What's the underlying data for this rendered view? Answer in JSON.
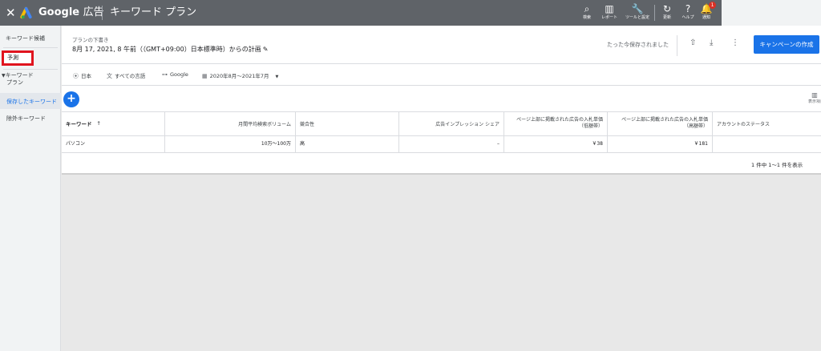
{
  "topbar": {
    "close": "✕",
    "brand_google": "Google",
    "brand_ads": "広告",
    "title": "キーワード プラン",
    "tools": [
      {
        "icon": "search-icon",
        "glyph": "⌕",
        "label": "検索"
      },
      {
        "icon": "report-icon",
        "glyph": "▥",
        "label": "レポート"
      },
      {
        "icon": "wrench-icon",
        "glyph": "🔧",
        "label": "ツールと設定"
      },
      {
        "icon": "refresh-icon",
        "glyph": "↻",
        "label": "更新"
      },
      {
        "icon": "help-icon",
        "glyph": "?",
        "label": "ヘルプ"
      },
      {
        "icon": "bell-icon",
        "glyph": "🔔",
        "label": "通知"
      }
    ],
    "notification_count": "1"
  },
  "sidebar": {
    "keyword_ideas": "キーワード候補",
    "forecast": "予測",
    "keyword_plan_line1": "キーワード",
    "keyword_plan_line2": "プラン",
    "saved_keywords": "保存したキーワード",
    "negative_keywords": "除外キーワード"
  },
  "header": {
    "draft_label": "プランの下書き",
    "plan_title": "8月 17, 2021, 8 午前（（GMT+09:00）日本標準時）からの計画",
    "saved_text": "たった今保存されました",
    "campaign_button": "キャンペーンの作成"
  },
  "filters": {
    "location": "日本",
    "language": "すべての言語",
    "network": "Google",
    "date_range": "2020年8月～2021年7月"
  },
  "columns_label": "表示項目",
  "table": {
    "headers": {
      "keyword": "キーワード",
      "sort_arrow": "↑",
      "volume": "月間平均検索ボリューム",
      "competition": "競合性",
      "impression_share": "広告インプレッション シェア",
      "bid_low_line1": "ページ上部に掲載された広告の入札単価",
      "bid_low_line2": "（低額帯）",
      "bid_high_line1": "ページ上部に掲載された広告の入札単価",
      "bid_high_line2": "（高額帯）",
      "account_status": "アカウントのステータス"
    },
    "rows": [
      {
        "keyword": "パソコン",
        "volume": "10万～100万",
        "competition": "高",
        "impression_share": "–",
        "bid_low": "￥38",
        "bid_high": "￥181",
        "account_status": ""
      }
    ]
  },
  "pagination": "1 件中 1～1 件を表示",
  "colors": {
    "topbar": "#5f6368",
    "primary_blue": "#1a73e8",
    "highlight_red": "#e0141e",
    "badge_red": "#d93025"
  }
}
